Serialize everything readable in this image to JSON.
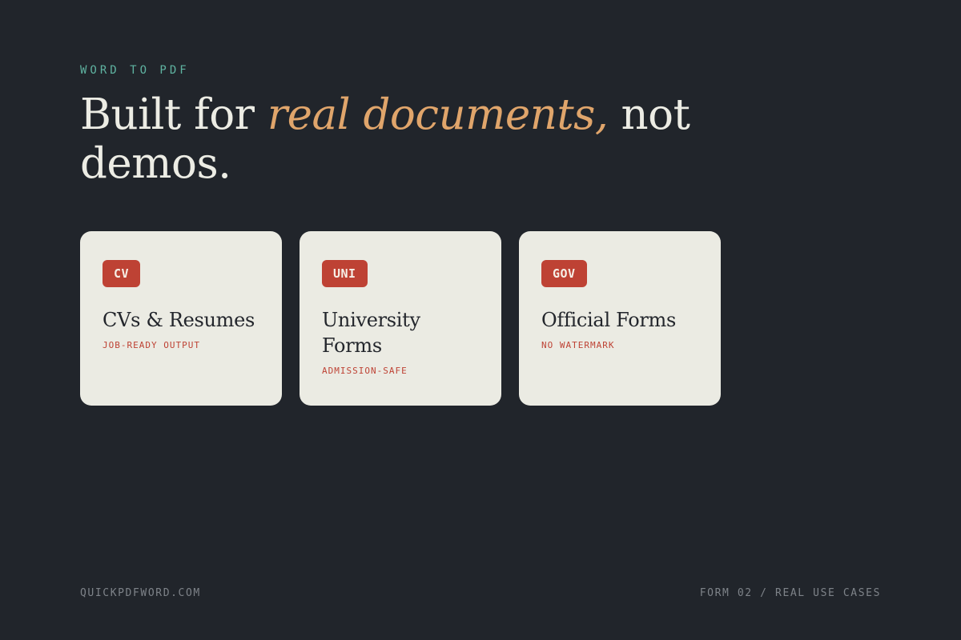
{
  "header": {
    "eyebrow": "WORD TO PDF",
    "headline_part1": "Built for ",
    "headline_accent": "real documents,",
    "headline_part2": " not demos."
  },
  "colors": {
    "background": "#21252b",
    "eyebrow": "#5fb3a1",
    "accent": "#e0a56b",
    "card_bg": "#ebebe3",
    "badge": "#be4234"
  },
  "cards": [
    {
      "badge": "CV",
      "title": "CVs & Resumes",
      "subtitle": "JOB-READY OUTPUT"
    },
    {
      "badge": "UNI",
      "title": "University Forms",
      "subtitle": "ADMISSION-SAFE"
    },
    {
      "badge": "GOV",
      "title": "Official Forms",
      "subtitle": "NO WATERMARK"
    }
  ],
  "footer": {
    "left": "QUICKPDFWORD.COM",
    "right": "FORM 02 / REAL USE CASES"
  }
}
